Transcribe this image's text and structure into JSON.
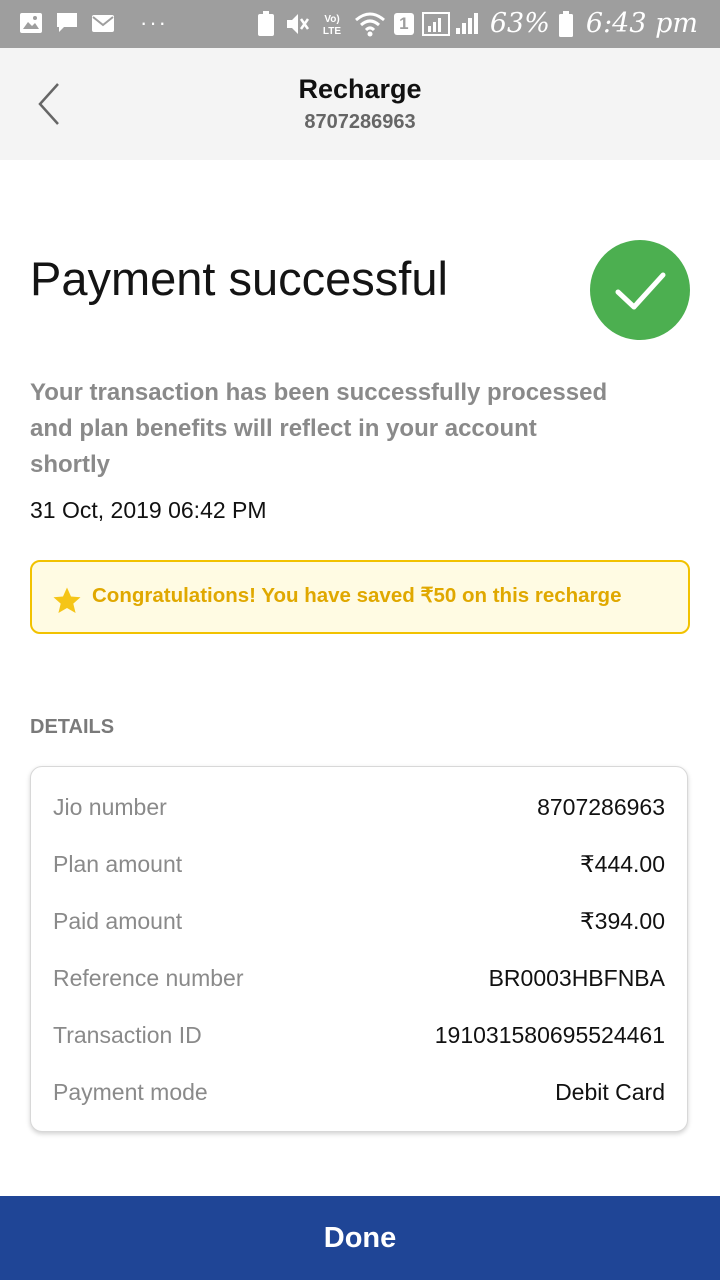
{
  "status_bar": {
    "battery_percent": "63%",
    "time": "6:43 pm",
    "sim_slot": "1",
    "lte_label": "LTE"
  },
  "header": {
    "title": "Recharge",
    "subtitle": "8707286963",
    "back_icon": "chevron-left-icon"
  },
  "result": {
    "title": "Payment successful",
    "message": "Your transaction has been successfully processed and plan benefits will reflect in your account shortly",
    "datetime": "31 Oct, 2019 06:42 PM",
    "status_icon": "check-icon",
    "status_color": "#4caf50"
  },
  "savings": {
    "icon": "star-icon",
    "text": "Congratulations! You have saved ₹50 on this recharge",
    "color": "#e0a800"
  },
  "details": {
    "label": "DETAILS",
    "rows": [
      {
        "label": "Jio number",
        "value": "8707286963"
      },
      {
        "label": "Plan amount",
        "value": "₹444.00"
      },
      {
        "label": "Paid amount",
        "value": "₹394.00"
      },
      {
        "label": "Reference number",
        "value": "BR0003HBFNBA"
      },
      {
        "label": "Transaction ID",
        "value": "191031580695524461"
      },
      {
        "label": "Payment mode",
        "value": "Debit Card"
      }
    ]
  },
  "done_button": {
    "label": "Done",
    "color": "#1f4596"
  }
}
